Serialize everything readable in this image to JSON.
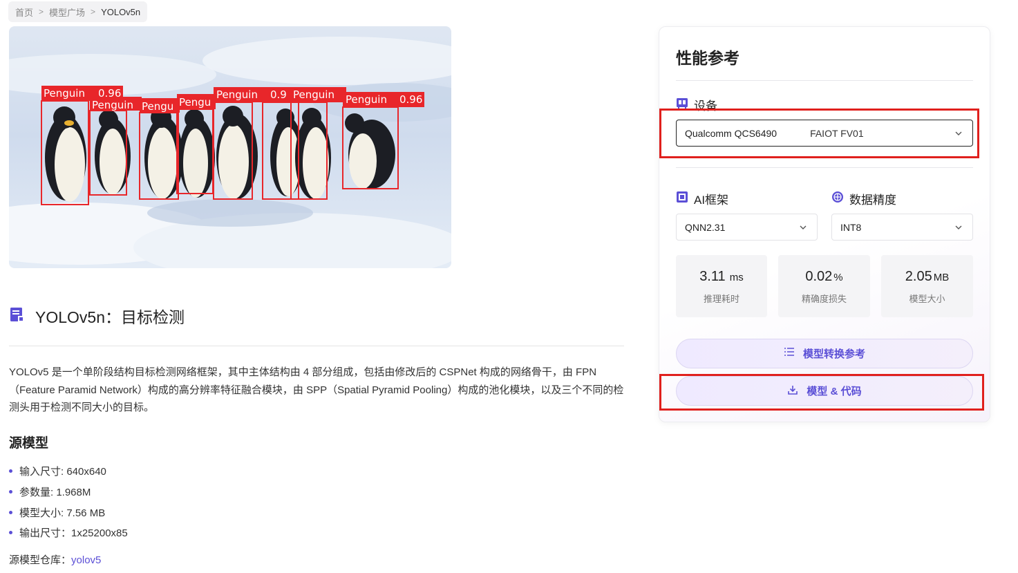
{
  "breadcrumb": {
    "home": "首页",
    "models": "模型广场",
    "current": "YOLOv5n"
  },
  "hero": {
    "labels": [
      {
        "text": "Penguin",
        "score": "0.96"
      },
      {
        "text": "Penguin",
        "score": ""
      },
      {
        "text": "Pengu",
        "score": ""
      },
      {
        "text": "Pengu",
        "score": ""
      },
      {
        "text": "Penguin",
        "score": "0.9"
      },
      {
        "text": "Penguin",
        "score": ""
      },
      {
        "text": "Penguin",
        "score": "0.96"
      }
    ]
  },
  "page": {
    "title": "YOLOv5n：目标检测",
    "description": "YOLOv5 是一个单阶段结构目标检测网络框架，其中主体结构由 4 部分组成，包括由修改后的 CSPNet 构成的网络骨干，由 FPN（Feature Paramid Network）构成的高分辨率特征融合模块，由 SPP（Spatial Pyramid Pooling）构成的池化模块，以及三个不同的检测头用于检测不同大小的目标。",
    "source_title": "源模型",
    "specs": [
      "输入尺寸: 640x640",
      "参数量: 1.968M",
      "模型大小: 7.56 MB",
      "输出尺寸：1x25200x85"
    ],
    "repo_label": "源模型仓库：",
    "repo_link": "yolov5"
  },
  "panel": {
    "title": "性能参考",
    "device_label": "设备",
    "device_value": "Qualcomm QCS6490",
    "device_sub": "FAIOT FV01",
    "framework_label": "AI框架",
    "framework_value": "QNN2.31",
    "precision_label": "数据精度",
    "precision_value": "INT8",
    "metrics": [
      {
        "value": "3.11",
        "unit": " ms",
        "label": "推理耗时"
      },
      {
        "value": "0.02",
        "unit": "%",
        "label": "精确度损失"
      },
      {
        "value": "2.05",
        "unit": "MB",
        "label": "模型大小"
      }
    ],
    "convert_button": "模型转换参考",
    "download_button": "模型 & 代码"
  },
  "colors": {
    "accent": "#5b4fd6",
    "annotation": "#e0201d",
    "bbox": "#e8262a"
  }
}
